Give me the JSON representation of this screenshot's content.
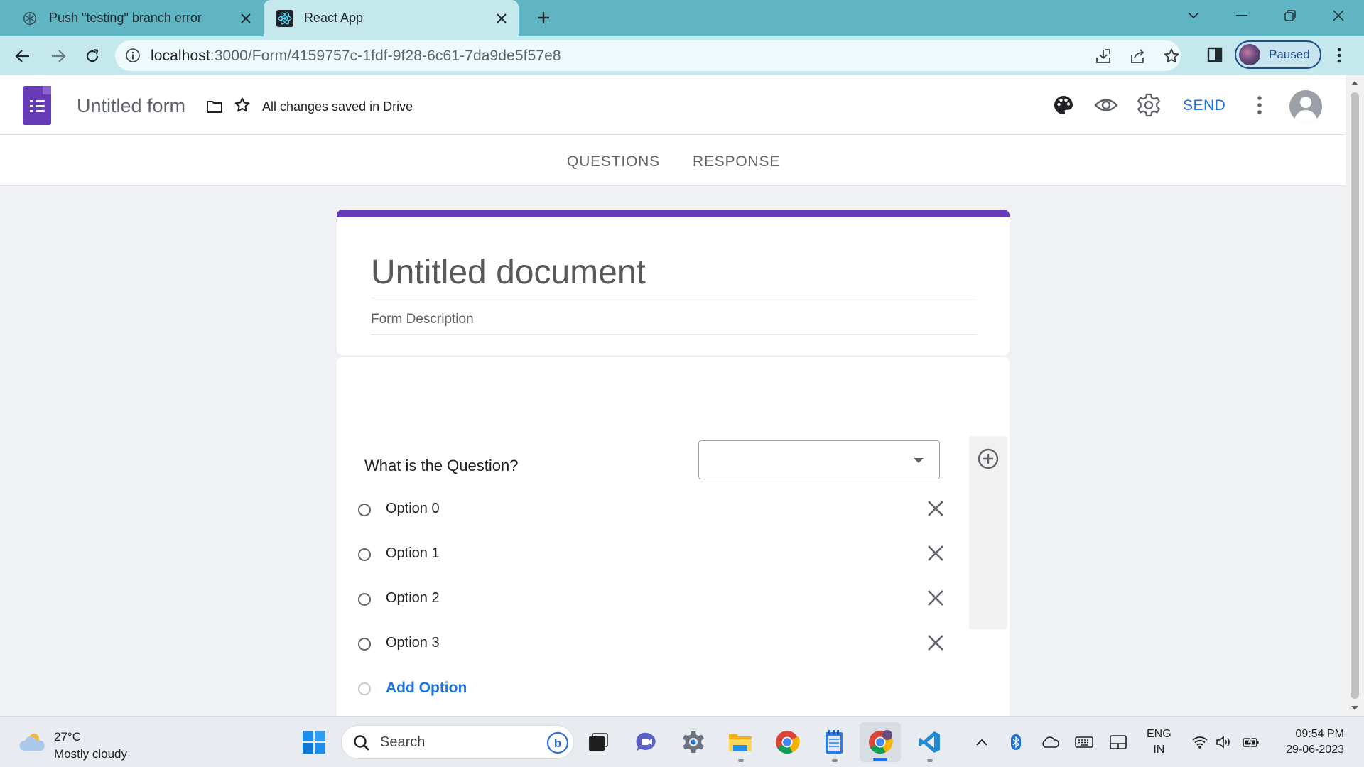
{
  "browser": {
    "tabs": [
      {
        "title": "Push \"testing\" branch error",
        "active": false,
        "favicon": "chatgpt-icon"
      },
      {
        "title": "React App",
        "active": true,
        "favicon": "react-icon"
      }
    ],
    "url_host": "localhost",
    "url_rest": ":3000/Form/4159757c-1fdf-9f28-6c61-7da9de5f57e8",
    "profile_label": "Paused"
  },
  "app": {
    "form_title": "Untitled form",
    "save_status": "All changes saved in Drive",
    "send_label": "SEND",
    "tabs": [
      "QUESTIONS",
      "RESPONSE"
    ],
    "accent_color": "#673ab7",
    "link_color": "#1a73e8"
  },
  "form": {
    "doc_title": "Untitled document",
    "description_placeholder": "Form Description",
    "question": {
      "text": "What is the Question?",
      "type_value": "",
      "options": [
        "Option 0",
        "Option 1",
        "Option 2",
        "Option 3"
      ],
      "add_option_label": "Add Option"
    }
  },
  "taskbar": {
    "weather_temp": "27°C",
    "weather_condition": "Mostly cloudy",
    "search_placeholder": "Search",
    "lang_line1": "ENG",
    "lang_line2": "IN",
    "time": "09:54 PM",
    "date": "29-06-2023"
  }
}
